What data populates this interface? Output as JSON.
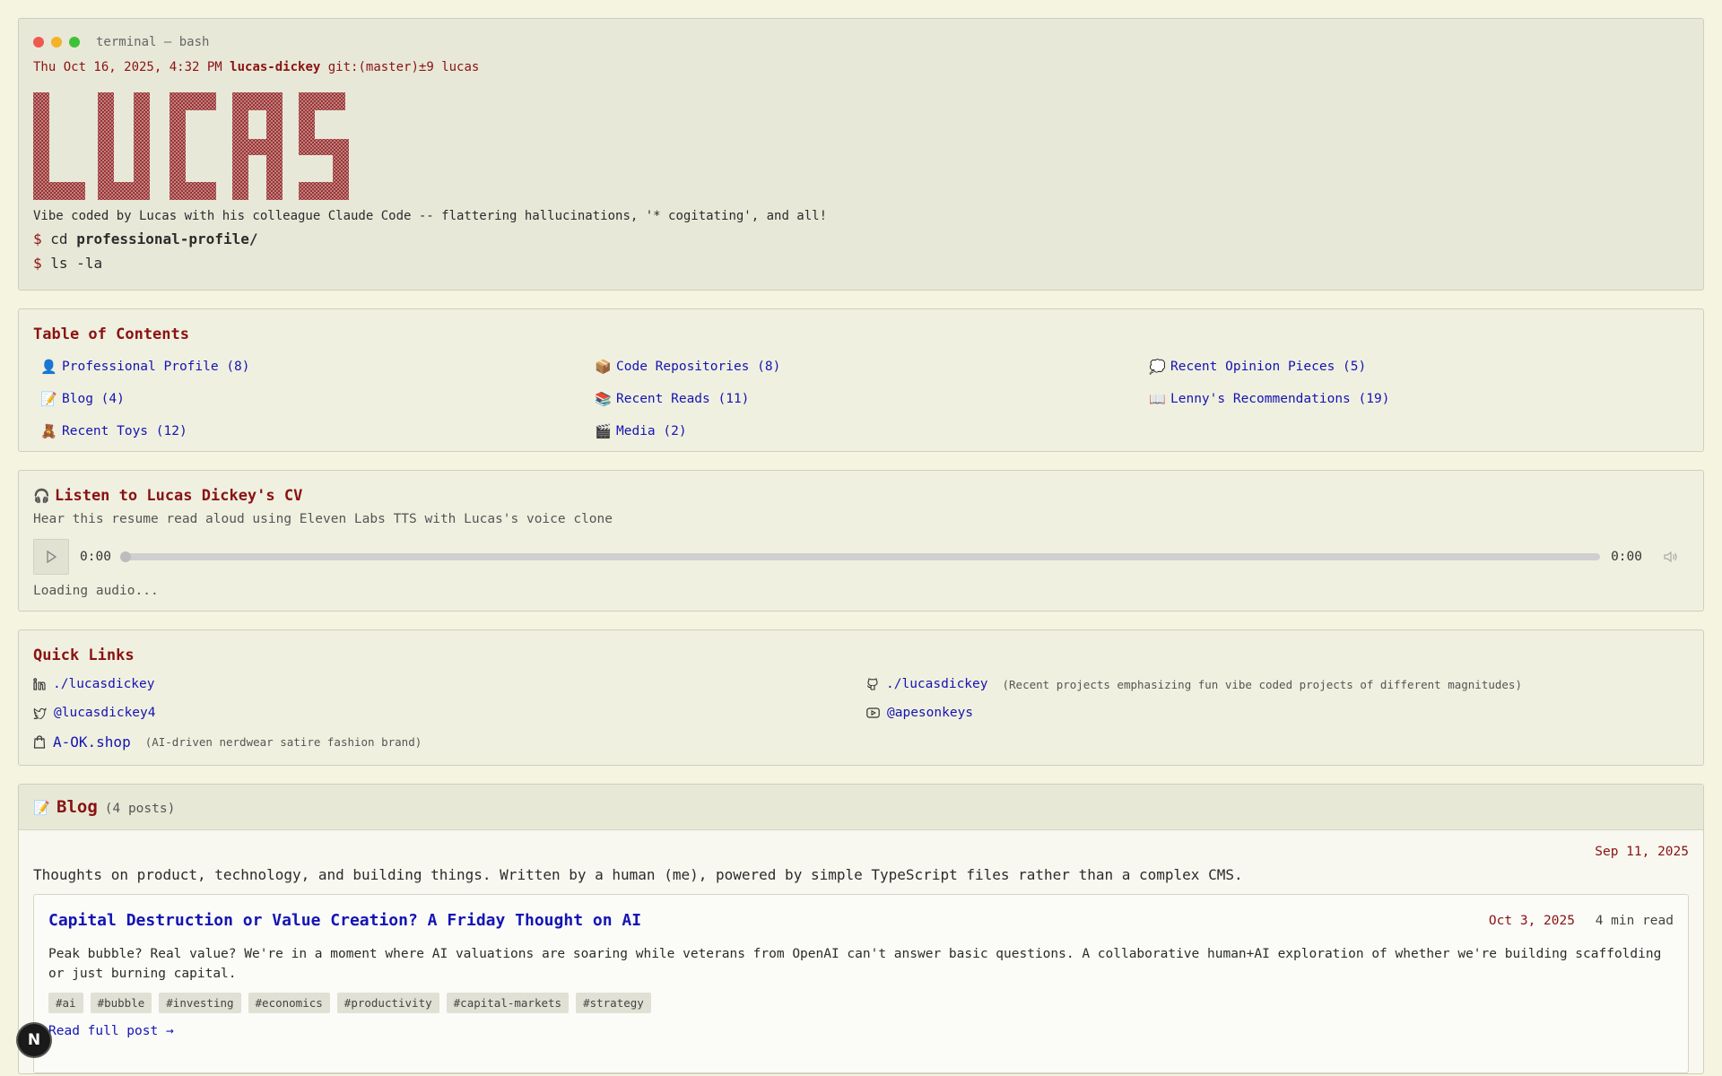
{
  "terminal": {
    "title": "terminal — bash",
    "prompt_datetime": "Thu Oct 16, 2025, 4:32 PM",
    "prompt_user": "lucas-dickey",
    "prompt_git": "git:(master)±9",
    "prompt_name": "lucas",
    "banner": "LUCAS",
    "tagline": "Vibe coded by Lucas with his colleague Claude Code -- flattering hallucinations, '* cogitating', and all!",
    "cmd1_prefix": "$",
    "cmd1_verb": "cd",
    "cmd1_arg": "professional-profile/",
    "cmd2_prefix": "$",
    "cmd2_text": "ls -la"
  },
  "toc": {
    "title": "Table of Contents",
    "items": [
      {
        "icon": "👤",
        "label": "Professional Profile (8)"
      },
      {
        "icon": "📦",
        "label": "Code Repositories (8)"
      },
      {
        "icon": "💭",
        "label": "Recent Opinion Pieces (5)"
      },
      {
        "icon": "📝",
        "label": "Blog (4)"
      },
      {
        "icon": "📚",
        "label": "Recent Reads (11)"
      },
      {
        "icon": "📖",
        "label": "Lenny's Recommendations (19)"
      },
      {
        "icon": "🧸",
        "label": "Recent Toys (12)"
      },
      {
        "icon": "🎬",
        "label": "Media (2)"
      }
    ]
  },
  "audio": {
    "icon": "🎧",
    "title": "Listen to Lucas Dickey's CV",
    "description": "Hear this resume read aloud using Eleven Labs TTS with Lucas's voice clone",
    "current_time": "0:00",
    "duration": "0:00",
    "progress": 0,
    "status": "Loading audio..."
  },
  "quick_links": {
    "title": "Quick Links",
    "linkedin": {
      "label": "./lucasdickey",
      "icon": "linkedin-icon"
    },
    "github": {
      "label": "./lucasdickey",
      "note": "(Recent projects emphasizing fun vibe coded projects of different magnitudes)",
      "icon": "github-icon"
    },
    "twitter": {
      "label": "@lucasdickey4",
      "icon": "twitter-icon"
    },
    "youtube": {
      "label": "@apesonkeys",
      "icon": "youtube-icon"
    },
    "shop": {
      "label": "A-OK.shop",
      "note": "(AI-driven nerdwear satire fashion brand)",
      "icon": "shopping-bag-icon"
    }
  },
  "blog": {
    "icon": "📝",
    "title": "Blog",
    "count": "(4 posts)",
    "updated": "Sep 11, 2025",
    "intro": "Thoughts on product, technology, and building things. Written by a human (me), powered by simple TypeScript files rather than a complex CMS.",
    "posts": [
      {
        "title": "Capital Destruction or Value Creation? A Friday Thought on AI",
        "date": "Oct 3, 2025",
        "read_time": "4 min read",
        "excerpt": "Peak bubble? Real value? We're in a moment where AI valuations are soaring while veterans from OpenAI can't answer basic questions. A collaborative human+AI exploration of whether we're building scaffolding or just burning capital.",
        "tags": [
          "#ai",
          "#bubble",
          "#investing",
          "#economics",
          "#productivity",
          "#capital-markets",
          "#strategy"
        ],
        "read_more": "Read full post →"
      }
    ]
  },
  "badge": {
    "letter": "N"
  },
  "colors": {
    "background": "#f5f4e0",
    "accent": "#8a1212",
    "link": "#1414b4"
  }
}
